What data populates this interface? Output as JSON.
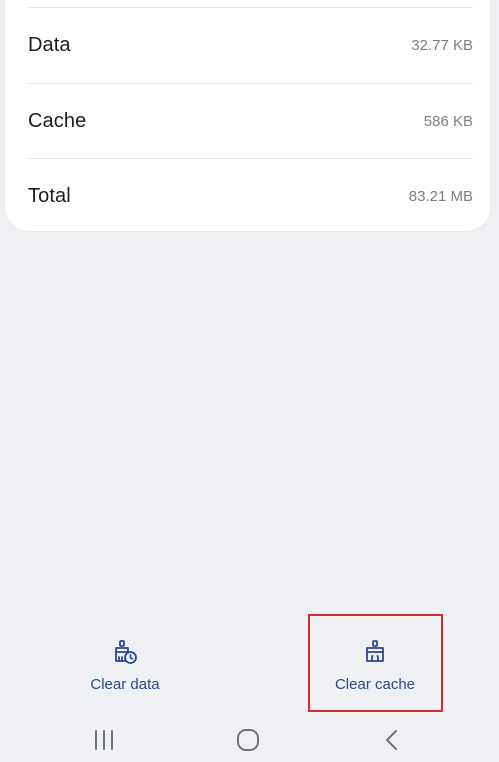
{
  "storage": {
    "rows": [
      {
        "label": "Data",
        "value": "32.77 KB"
      },
      {
        "label": "Cache",
        "value": "586 KB"
      },
      {
        "label": "Total",
        "value": "83.21 MB"
      }
    ]
  },
  "actions": {
    "clear_data": {
      "label": "Clear data",
      "icon": "broom-clock-icon"
    },
    "clear_cache": {
      "label": "Clear cache",
      "icon": "broom-icon"
    }
  },
  "navbar": {
    "recents": "recents-icon",
    "home": "home-icon",
    "back": "back-icon"
  },
  "colors": {
    "accent": "#2c4a8c",
    "highlight": "#d62b2b",
    "background": "#eef0f3"
  }
}
